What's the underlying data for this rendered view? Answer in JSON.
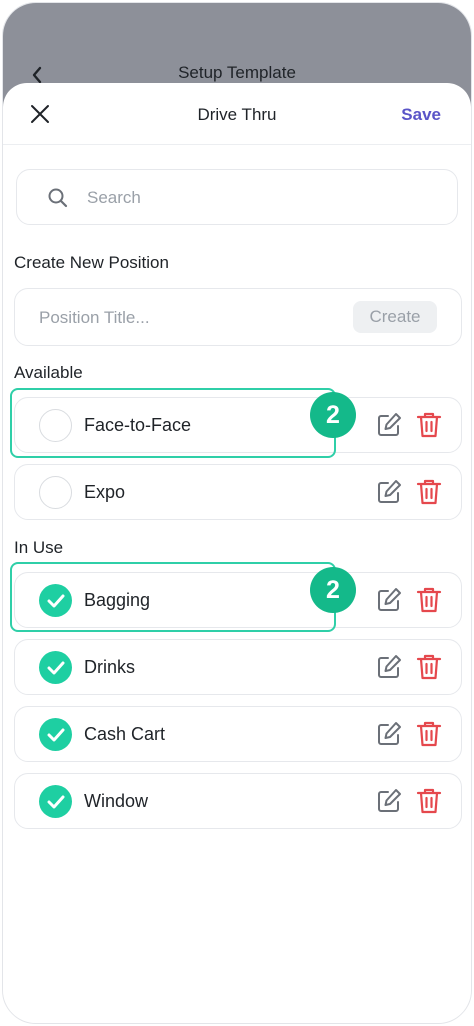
{
  "background_screen": {
    "title": "Setup Template"
  },
  "sheet": {
    "title": "Drive Thru",
    "save_label": "Save"
  },
  "search": {
    "placeholder": "Search",
    "value": ""
  },
  "create_section": {
    "heading": "Create New Position",
    "input_placeholder": "Position Title...",
    "button_label": "Create"
  },
  "available": {
    "heading": "Available",
    "items": [
      {
        "label": "Face-to-Face",
        "selected": false
      },
      {
        "label": "Expo",
        "selected": false
      }
    ]
  },
  "in_use": {
    "heading": "In Use",
    "items": [
      {
        "label": "Bagging",
        "selected": true
      },
      {
        "label": "Drinks",
        "selected": true
      },
      {
        "label": "Cash Cart",
        "selected": true
      },
      {
        "label": "Window",
        "selected": true
      }
    ]
  },
  "annotations": [
    {
      "badge": "2"
    },
    {
      "badge": "2"
    }
  ],
  "colors": {
    "accent": "#5a55c8",
    "check": "#1ecfa2",
    "badge": "#14b98a",
    "highlight": "#2fcfa8",
    "delete": "#e5484d",
    "edit": "#6b7078"
  }
}
